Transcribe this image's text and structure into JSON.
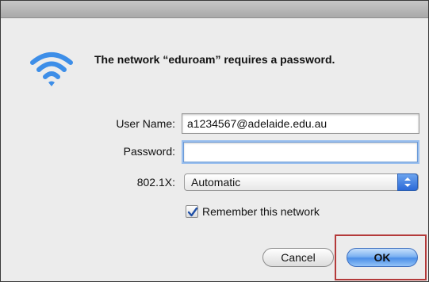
{
  "dialog": {
    "message": "The network “eduroam” requires a password.",
    "icon": "wifi-icon"
  },
  "form": {
    "username_label": "User Name:",
    "username_value": "a1234567@adelaide.edu.au",
    "password_label": "Password:",
    "password_value": "",
    "eap_label": "802.1X:",
    "eap_value": "Automatic",
    "remember_label": "Remember this network",
    "remember_checked": true
  },
  "buttons": {
    "cancel_label": "Cancel",
    "ok_label": "OK"
  },
  "colors": {
    "accent": "#3d8ee8",
    "highlight": "#b43a3a"
  }
}
